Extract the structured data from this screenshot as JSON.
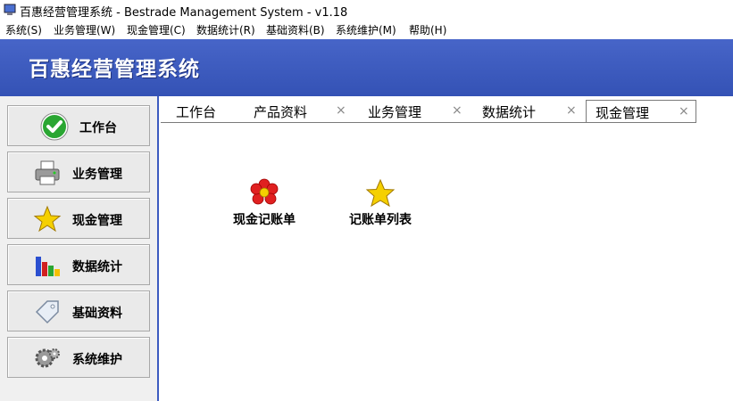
{
  "window": {
    "title": "百惠经营管理系统 - Bestrade Management System - v1.18"
  },
  "menu": [
    {
      "label": "系统(S)"
    },
    {
      "label": "业务管理(W)"
    },
    {
      "label": "现金管理(C)"
    },
    {
      "label": "数据统计(R)"
    },
    {
      "label": "基础资料(B)"
    },
    {
      "label": "系统维护(M)"
    },
    {
      "label": "帮助(H)"
    }
  ],
  "banner": {
    "title": "百惠经营管理系统"
  },
  "sidebar": [
    {
      "label": "工作台",
      "icon": "green-check-icon"
    },
    {
      "label": "业务管理",
      "icon": "printer-icon"
    },
    {
      "label": "现金管理",
      "icon": "star-icon"
    },
    {
      "label": "数据统计",
      "icon": "bar-chart-icon"
    },
    {
      "label": "基础资料",
      "icon": "tag-icon"
    },
    {
      "label": "系统维护",
      "icon": "gears-icon"
    }
  ],
  "tabs": [
    {
      "label": "工作台",
      "closable": false
    },
    {
      "label": "产品资料",
      "closable": true
    },
    {
      "label": "业务管理",
      "closable": true
    },
    {
      "label": "数据统计",
      "closable": true
    },
    {
      "label": "现金管理",
      "closable": true,
      "active": true
    }
  ],
  "close_glyph": "×",
  "shortcuts": [
    {
      "label": "现金记账单",
      "icon": "red-flower-icon"
    },
    {
      "label": "记账单列表",
      "icon": "star-icon"
    }
  ],
  "colors": {
    "banner": "#3d5cc0",
    "accent_green": "#22a02a",
    "star": "#f5d000"
  }
}
